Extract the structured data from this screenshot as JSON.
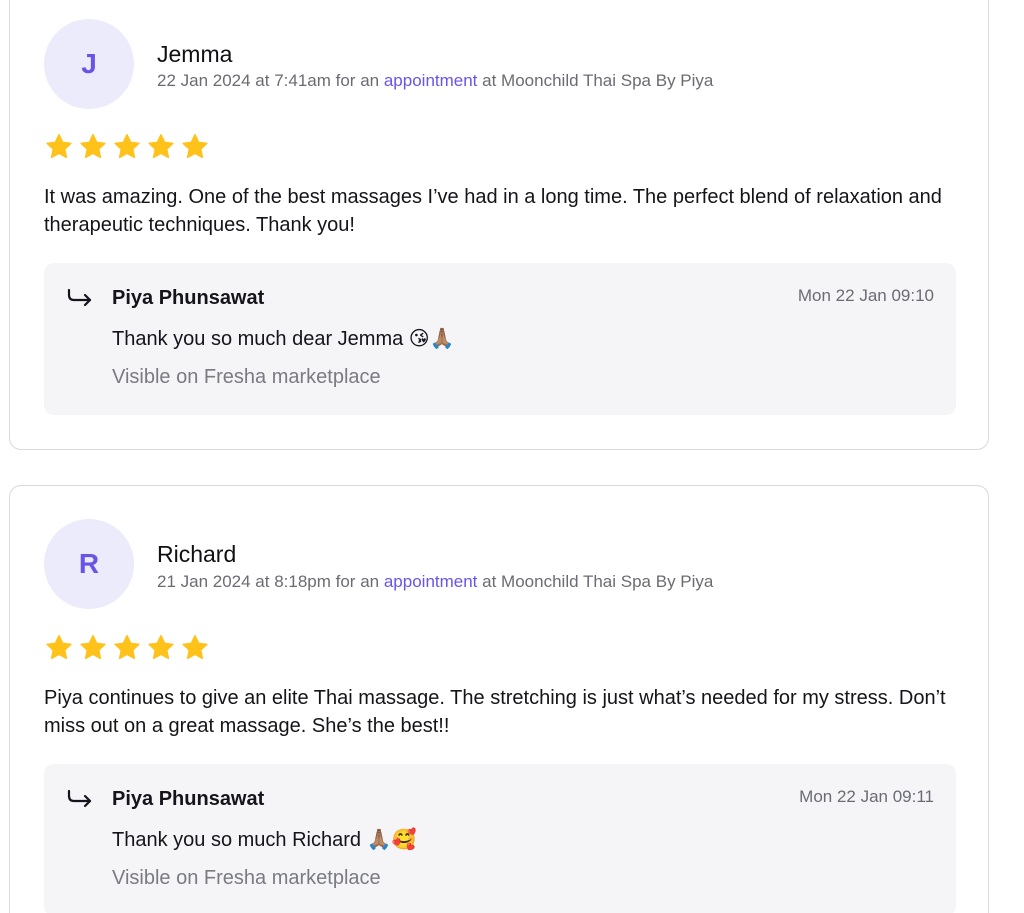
{
  "reviews": [
    {
      "avatar_initial": "J",
      "name": "Jemma",
      "date": "22 Jan 2024 at 7:41am for an",
      "link": "appointment",
      "location": "at Moonchild Thai Spa By Piya",
      "rating": 5,
      "text": "It was amazing. One of the best massages I’ve had in a long time. The perfect blend of relaxation and therapeutic techniques. Thank you!",
      "reply": {
        "author": "Piya Phunsawat",
        "time": "Mon 22 Jan 09:10",
        "text": "Thank you so much dear Jemma 😘🙏🏽",
        "visibility": "Visible on Fresha marketplace"
      }
    },
    {
      "avatar_initial": "R",
      "name": "Richard",
      "date": "21 Jan 2024 at 8:18pm for an",
      "link": "appointment",
      "location": "at Moonchild Thai Spa By Piya",
      "rating": 5,
      "text": "Piya continues to give an elite Thai massage. The stretching is just what’s needed for my stress. Don’t miss out on a great massage. She’s the best!!",
      "reply": {
        "author": "Piya Phunsawat",
        "time": "Mon 22 Jan 09:11",
        "text": "Thank you so much Richard 🙏🏽🥰",
        "visibility": "Visible on Fresha marketplace"
      }
    }
  ],
  "colors": {
    "accent": "#6954e8",
    "star": "#ffc21a",
    "avatar_bg": "#ebebfb",
    "reply_bg": "#f5f5f8"
  },
  "icons": {
    "star": "star-icon",
    "reply": "reply-arrow-icon"
  }
}
